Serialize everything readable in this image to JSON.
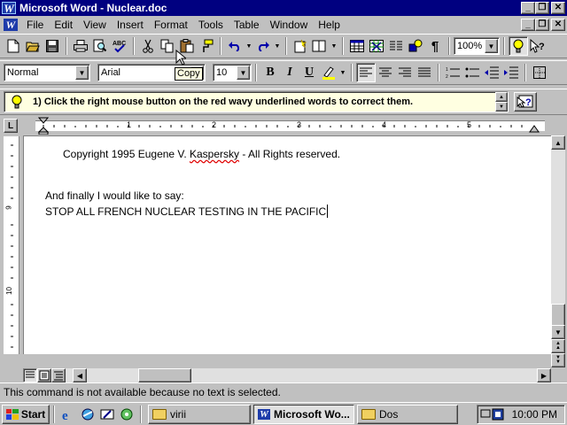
{
  "window": {
    "title": "Microsoft Word - Nuclear.doc",
    "app_letter": "W"
  },
  "caption_buttons": {
    "minimize": "_",
    "restore": "❐",
    "close": "✕"
  },
  "menu": {
    "items": [
      "File",
      "Edit",
      "View",
      "Insert",
      "Format",
      "Tools",
      "Table",
      "Window",
      "Help"
    ]
  },
  "standard_toolbar": {
    "zoom_value": "100%",
    "tooltip": "Copy"
  },
  "formatting_toolbar": {
    "style_value": "Normal",
    "font_value": "Arial",
    "size_value": "10",
    "bold_label": "B",
    "italic_label": "I",
    "underline_label": "U"
  },
  "tip": {
    "text": "1) Click the right mouse button on the red wavy underlined words to correct them."
  },
  "ruler": {
    "corner": "L",
    "numbers": [
      "1",
      "2",
      "3",
      "4",
      "5"
    ]
  },
  "vruler": {
    "numbers": [
      "9",
      "10"
    ]
  },
  "document": {
    "copyright_before": "Copyright 1995 Eugene V. ",
    "copyright_misspelled": "Kaspersky",
    "copyright_after": " - All Rights reserved.",
    "line2": "And finally I would like to say:",
    "line3": "STOP ALL FRENCH NUCLEAR TESTING IN THE PACIFIC"
  },
  "status": {
    "text": "This command is not available because no text is selected."
  },
  "taskbar": {
    "start_label": "Start",
    "tasks": [
      {
        "label": "virii"
      },
      {
        "label": "Microsoft Wo..."
      },
      {
        "label": "Dos"
      }
    ],
    "clock": "10:00 PM"
  },
  "colors": {
    "titlebar": "#000080",
    "desktop_gray": "#c0c0c0",
    "tip_background": "#ffffe1",
    "spell_underline": "#e00000"
  }
}
